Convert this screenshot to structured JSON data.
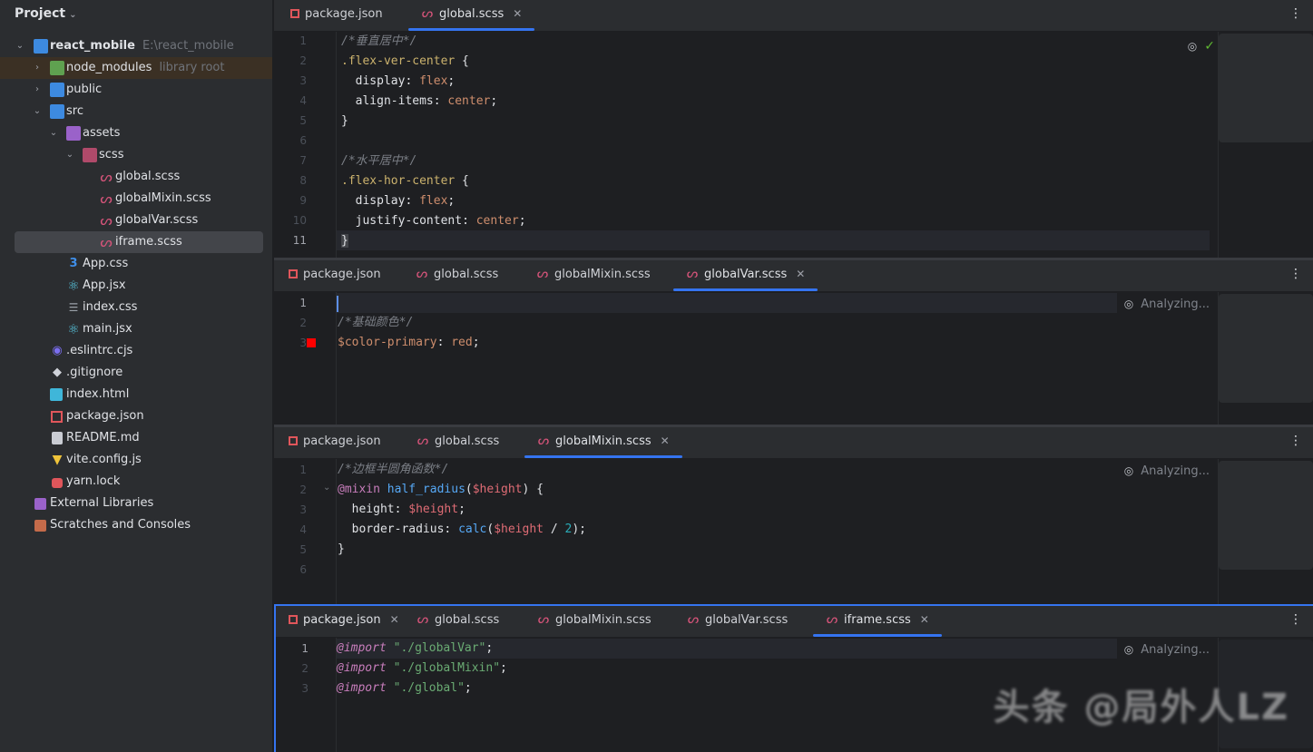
{
  "sidebar": {
    "title": "Project",
    "project_name": "react_mobile",
    "project_path": "E:\\react_mobile",
    "items": {
      "node_modules": "node_modules",
      "node_modules_hint": "library root",
      "public": "public",
      "src": "src",
      "assets": "assets",
      "scss": "scss",
      "global_scss": "global.scss",
      "globalMixin_scss": "globalMixin.scss",
      "globalVar_scss": "globalVar.scss",
      "iframe_scss": "iframe.scss",
      "app_css": "App.css",
      "app_jsx": "App.jsx",
      "index_css": "index.css",
      "main_jsx": "main.jsx",
      "eslintrc": ".eslintrc.cjs",
      "gitignore": ".gitignore",
      "index_html": "index.html",
      "package_json": "package.json",
      "readme": "README.md",
      "vite_config": "vite.config.js",
      "yarn_lock": "yarn.lock",
      "external_libraries": "External Libraries",
      "scratches": "Scratches and Consoles"
    }
  },
  "panes": {
    "p1": {
      "tabs": [
        "package.json",
        "global.scss"
      ],
      "active": "global.scss",
      "line_numbers": [
        "1",
        "2",
        "3",
        "4",
        "5",
        "6",
        "7",
        "8",
        "9",
        "10",
        "11"
      ],
      "code": {
        "l1": "/*垂直居中*/",
        "l2_sel": ".flex-ver-center",
        "l2_rest": " {",
        "l3_prop": "  display",
        "l3_val": "flex",
        "l4_prop": "  align-items",
        "l4_val": "center",
        "l5": "}",
        "l7": "/*水平居中*/",
        "l8_sel": ".flex-hor-center",
        "l8_rest": " {",
        "l9_prop": "  display",
        "l9_val": "flex",
        "l10_prop": "  justify-content",
        "l10_val": "center",
        "l11": "}"
      }
    },
    "p2": {
      "tabs": [
        "package.json",
        "global.scss",
        "globalMixin.scss",
        "globalVar.scss"
      ],
      "active": "globalVar.scss",
      "status": "Analyzing...",
      "line_numbers": [
        "1",
        "2",
        "3"
      ],
      "code": {
        "l2": "/*基础颜色*/",
        "l3_var": "$color-primary",
        "l3_val": "red"
      },
      "swatch_color": "#ff0000"
    },
    "p3": {
      "tabs": [
        "package.json",
        "global.scss",
        "globalMixin.scss"
      ],
      "active": "globalMixin.scss",
      "status": "Analyzing...",
      "line_numbers": [
        "1",
        "2",
        "3",
        "4",
        "5",
        "6"
      ],
      "code": {
        "l1": "/*边框半圆角函数*/",
        "l2_kw": "@mixin",
        "l2_fn": "half_radius",
        "l2_arg": "$height",
        "l3_prop": "  height",
        "l3_var": "$height",
        "l4_prop": "  border-radius",
        "l4_fn": "calc",
        "l4_var": "$height",
        "l4_num": "2",
        "l5": "}"
      }
    },
    "p4": {
      "tabs": [
        "package.json",
        "global.scss",
        "globalMixin.scss",
        "globalVar.scss",
        "iframe.scss"
      ],
      "active": "iframe.scss",
      "status": "Analyzing...",
      "line_numbers": [
        "1",
        "2",
        "3"
      ],
      "code": {
        "kw": "@import",
        "l1_str": "\"./globalVar\"",
        "l2_str": "\"./globalMixin\"",
        "l3_str": "\"./global\""
      }
    }
  },
  "watermark": "头条 @局外人LZ"
}
